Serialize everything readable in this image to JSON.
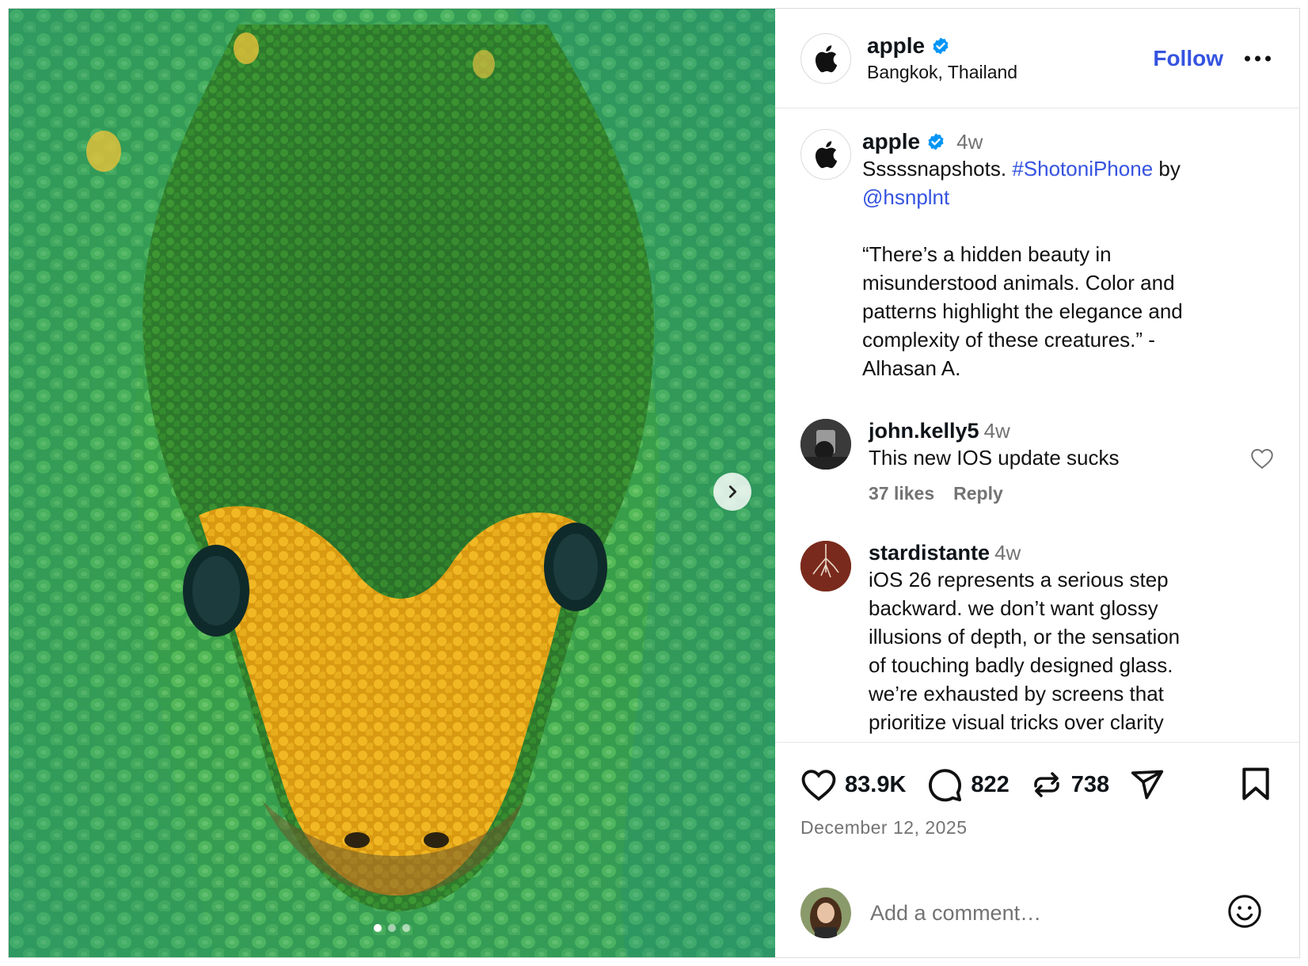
{
  "media": {
    "image_alt": "Close-up photo of a green snake's head",
    "slide_count": 3,
    "active_slide": 1
  },
  "header": {
    "username": "apple",
    "location": "Bangkok, Thailand",
    "follow_label": "Follow"
  },
  "caption": {
    "username": "apple",
    "time": "4w",
    "text_lead": "Sssssnapshots.",
    "hashtag": "#ShotoniPhone",
    "by": "by",
    "mention": "@hsnplnt",
    "quote_lines": [
      "“There’s a hidden beauty in",
      "misunderstood animals. Color and",
      "patterns highlight the elegance and",
      "complexity of these creatures.” -",
      "Alhasan A."
    ]
  },
  "comments": [
    {
      "username": "john.kelly5",
      "time": "4w",
      "text_lines": [
        "This new IOS update sucks"
      ],
      "likes": "37 likes",
      "reply_label": "Reply"
    },
    {
      "username": "stardistante",
      "time": "4w",
      "text_lines": [
        "iOS 26 represents a serious step",
        "backward. we don’t want glossy",
        "illusions of depth, or the sensation",
        "of touching badly designed glass.",
        "we’re exhausted by screens that",
        "prioritize visual tricks over clarity"
      ]
    }
  ],
  "actions": {
    "likes": "83.9K",
    "comments": "822",
    "reposts": "738",
    "date": "December 12, 2025"
  },
  "composer": {
    "placeholder": "Add a comment…"
  },
  "colors": {
    "accent": "#3553e0",
    "verified": "#0095f6",
    "muted": "#737373",
    "border": "#dbdbdb"
  },
  "icons": [
    "apple-logo-icon",
    "verified-badge-icon",
    "more-icon",
    "chevron-right-icon",
    "heart-icon",
    "comment-icon",
    "repost-icon",
    "share-icon",
    "bookmark-icon",
    "emoji-icon"
  ]
}
